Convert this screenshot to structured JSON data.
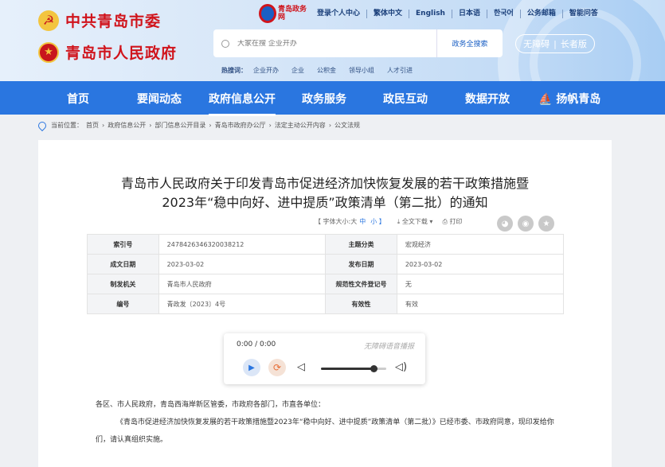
{
  "header": {
    "party_name": "中共青岛市委",
    "gov_name": "青岛市人民政府",
    "portal_logo_text": "青岛政务网",
    "top_links": [
      "登录个人中心",
      "繁体中文",
      "English",
      "日本语",
      "한국어",
      "公务邮箱",
      "智能问答"
    ],
    "search_placeholder": "大家在搜 企业开办",
    "search_button": "政务全搜索",
    "access_labels": [
      "无障碍",
      "长者版"
    ],
    "hotwords_label": "热搜词：",
    "hotwords": [
      "企业开办",
      "企业",
      "公积金",
      "领导小组",
      "人才引进"
    ]
  },
  "nav": {
    "items": [
      "首页",
      "要闻动态",
      "政府信息公开",
      "政务服务",
      "政民互动",
      "数据开放",
      "扬帆青岛"
    ],
    "active_index": 2
  },
  "breadcrumb": {
    "prefix": "当前位置：",
    "items": [
      "首页",
      "政府信息公开",
      "部门信息公开目录",
      "青岛市政府办公厅",
      "法定主动公开内容",
      "公文法规"
    ]
  },
  "article": {
    "title_line1": "青岛市人民政府关于印发青岛市促进经济加快恢复发展的若干政策措施暨",
    "title_line2": "2023年“稳中向好、进中提质”政策清单（第二批）的通知",
    "font_size_label": "【 字体大小:",
    "size_large": "大",
    "size_medium": "中",
    "size_small": "小 】",
    "download_label": "全文下载",
    "print_label": "打印"
  },
  "meta": {
    "rows": [
      {
        "k1": "索引号",
        "v1": "2478426346320038212",
        "k2": "主题分类",
        "v2": "宏观经济"
      },
      {
        "k1": "成文日期",
        "v1": "2023-03-02",
        "k2": "发布日期",
        "v2": "2023-03-02"
      },
      {
        "k1": "制发机关",
        "v1": "青岛市人民政府",
        "k2": "规范性文件登记号",
        "v2": "无"
      },
      {
        "k1": "编号",
        "v1": "青政发〔2023〕4号",
        "k2": "有效性",
        "v2": "有效"
      }
    ]
  },
  "player": {
    "time": "0:00 / 0:00",
    "tag": "无障碍语音播报",
    "volume": 0.8
  },
  "body": {
    "para1": "各区、市人民政府，青岛西海岸新区管委，市政府各部门，市直各单位：",
    "para2": "《青岛市促进经济加快恢复发展的若干政策措施暨2023年“稳中向好、进中提质”政策清单（第二批）》已经市委、市政府同意，现印发给你们，请认真组织实施。"
  }
}
